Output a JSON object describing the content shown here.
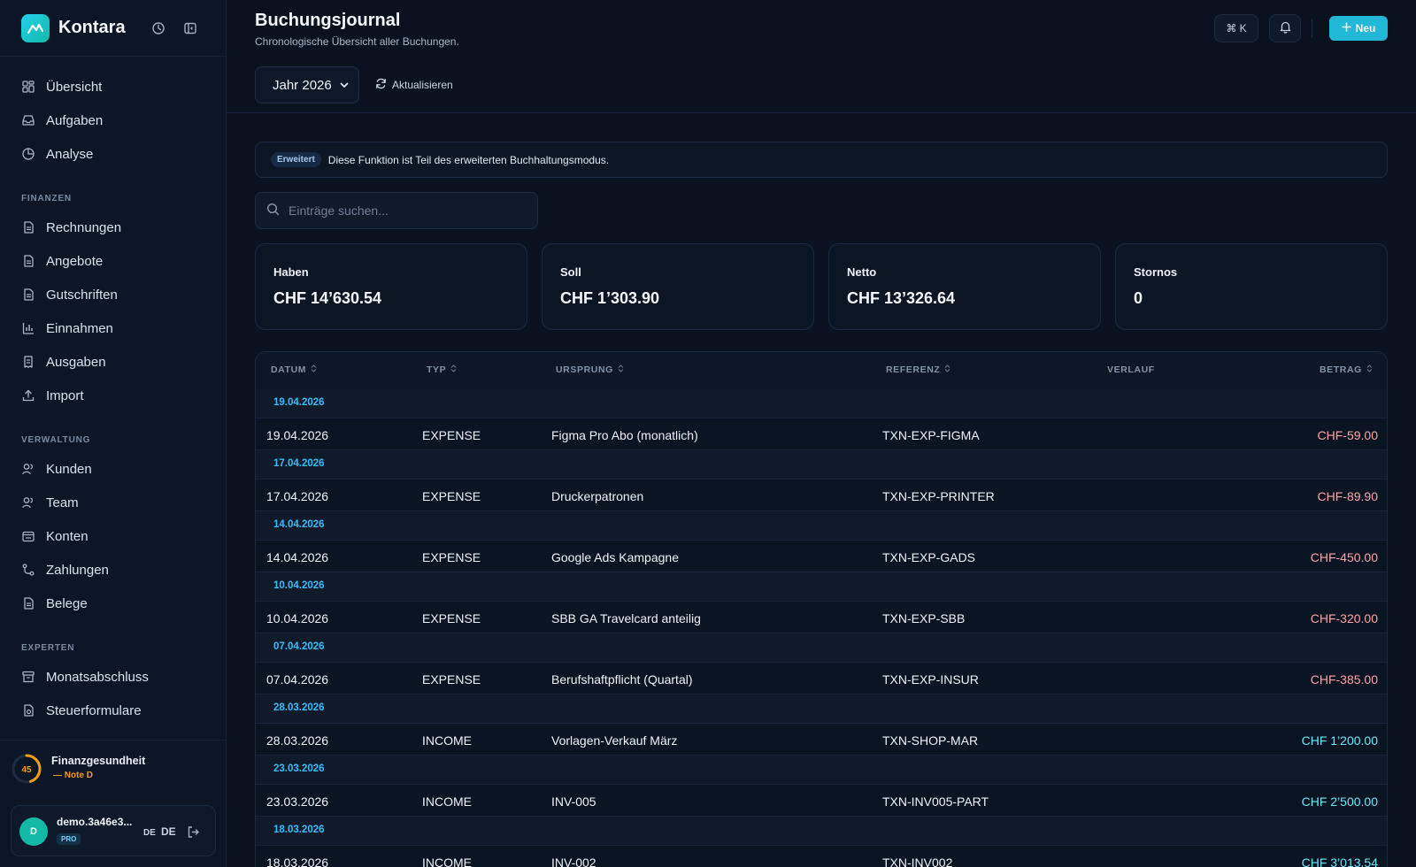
{
  "app": {
    "name": "Kontara"
  },
  "sidebar": {
    "top_items": [
      {
        "label": "Übersicht",
        "icon": "grid-icon"
      },
      {
        "label": "Aufgaben",
        "icon": "inbox-icon"
      },
      {
        "label": "Analyse",
        "icon": "pie-chart-icon"
      }
    ],
    "sections": [
      {
        "title": "FINANZEN",
        "items": [
          "Rechnungen",
          "Angebote",
          "Gutschriften",
          "Einnahmen",
          "Ausgaben",
          "Import"
        ]
      },
      {
        "title": "VERWALTUNG",
        "items": [
          "Kunden",
          "Team",
          "Konten",
          "Zahlungen",
          "Belege"
        ]
      },
      {
        "title": "EXPERTEN",
        "items": [
          "Monatsabschluss",
          "Steuerformulare"
        ]
      }
    ],
    "health": {
      "score": "45",
      "score_fraction": 0.45,
      "title": "Finanzgesundheit",
      "note": "— Note D"
    },
    "user": {
      "avatar": "D",
      "name": "demo.3a46e3...",
      "plan": "PRO",
      "lang_small": "DE",
      "lang_big": "DE"
    }
  },
  "header": {
    "title": "Buchungsjournal",
    "subtitle": "Chronologische Übersicht aller Buchungen.",
    "kbd": "⌘ K",
    "new_label": "Neu"
  },
  "toolbar": {
    "year": "Jahr 2026",
    "refresh_label": "Aktualisieren"
  },
  "notice": {
    "badge": "Erweitert",
    "text": "Diese Funktion ist Teil des erweiterten Buchhaltungsmodus."
  },
  "search": {
    "placeholder": "Einträge suchen..."
  },
  "stats": [
    {
      "label": "Haben",
      "value": "CHF 14’630.54"
    },
    {
      "label": "Soll",
      "value": "CHF 1’303.90"
    },
    {
      "label": "Netto",
      "value": "CHF 13’326.64"
    },
    {
      "label": "Stornos",
      "value": "0"
    }
  ],
  "table": {
    "columns": [
      "DATUM",
      "TYP",
      "URSPRUNG",
      "REFERENZ",
      "VERLAUF",
      "BETRAG"
    ],
    "groups": [
      {
        "date": "19.04.2026",
        "rows": [
          {
            "date": "19.04.2026",
            "type": "EXPENSE",
            "origin": "Figma Pro Abo (monatlich)",
            "ref": "TXN-EXP-FIGMA",
            "amount": "CHF-59.00",
            "sign": "neg"
          }
        ]
      },
      {
        "date": "17.04.2026",
        "rows": [
          {
            "date": "17.04.2026",
            "type": "EXPENSE",
            "origin": "Druckerpatronen",
            "ref": "TXN-EXP-PRINTER",
            "amount": "CHF-89.90",
            "sign": "neg"
          }
        ]
      },
      {
        "date": "14.04.2026",
        "rows": [
          {
            "date": "14.04.2026",
            "type": "EXPENSE",
            "origin": "Google Ads Kampagne",
            "ref": "TXN-EXP-GADS",
            "amount": "CHF-450.00",
            "sign": "neg"
          }
        ]
      },
      {
        "date": "10.04.2026",
        "rows": [
          {
            "date": "10.04.2026",
            "type": "EXPENSE",
            "origin": "SBB GA Travelcard anteilig",
            "ref": "TXN-EXP-SBB",
            "amount": "CHF-320.00",
            "sign": "neg"
          }
        ]
      },
      {
        "date": "07.04.2026",
        "rows": [
          {
            "date": "07.04.2026",
            "type": "EXPENSE",
            "origin": "Berufshaftpflicht (Quartal)",
            "ref": "TXN-EXP-INSUR",
            "amount": "CHF-385.00",
            "sign": "neg"
          }
        ]
      },
      {
        "date": "28.03.2026",
        "rows": [
          {
            "date": "28.03.2026",
            "type": "INCOME",
            "origin": "Vorlagen-Verkauf März",
            "ref": "TXN-SHOP-MAR",
            "amount": "CHF 1’200.00",
            "sign": "pos"
          }
        ]
      },
      {
        "date": "23.03.2026",
        "rows": [
          {
            "date": "23.03.2026",
            "type": "INCOME",
            "origin": "INV-005",
            "ref": "TXN-INV005-PART",
            "amount": "CHF 2’500.00",
            "sign": "pos"
          }
        ]
      },
      {
        "date": "18.03.2026",
        "rows": [
          {
            "date": "18.03.2026",
            "type": "INCOME",
            "origin": "INV-002",
            "ref": "TXN-INV002",
            "amount": "CHF 3’013.54",
            "sign": "pos"
          }
        ]
      }
    ]
  },
  "colors": {
    "accent": "#22b8d8",
    "background": "#0a1220",
    "sidebar": "#0c1626",
    "negative": "#fca5a5",
    "positive": "#67e8f9",
    "health": "#f59e0b"
  }
}
